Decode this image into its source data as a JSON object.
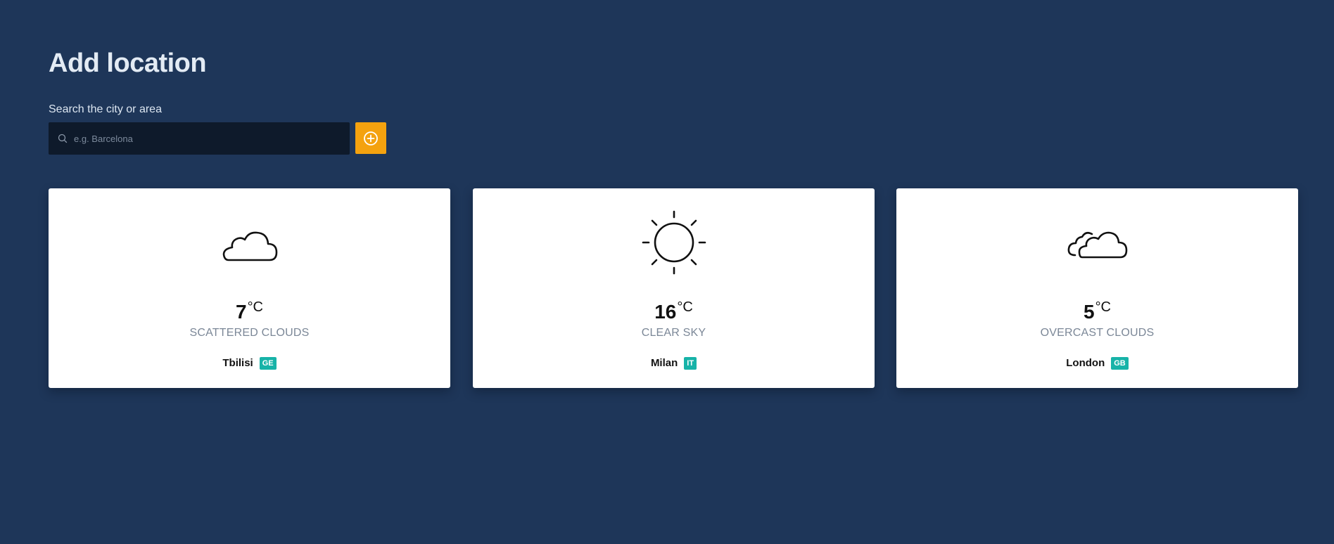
{
  "header": {
    "title": "Add location"
  },
  "search": {
    "label": "Search the city or area",
    "placeholder": "e.g. Barcelona",
    "value": "",
    "add_button_icon": "plus-circle-icon"
  },
  "colors": {
    "background": "#1e3659",
    "accent": "#f4a20f",
    "badge": "#17b3a8",
    "card": "#ffffff"
  },
  "cards": [
    {
      "icon": "cloud-icon",
      "temperature": "7",
      "unit": "°C",
      "description": "SCATTERED CLOUDS",
      "city": "Tbilisi",
      "country": "GE"
    },
    {
      "icon": "sun-icon",
      "temperature": "16",
      "unit": "°C",
      "description": "CLEAR SKY",
      "city": "Milan",
      "country": "IT"
    },
    {
      "icon": "overcast-clouds-icon",
      "temperature": "5",
      "unit": "°C",
      "description": "OVERCAST CLOUDS",
      "city": "London",
      "country": "GB"
    }
  ]
}
